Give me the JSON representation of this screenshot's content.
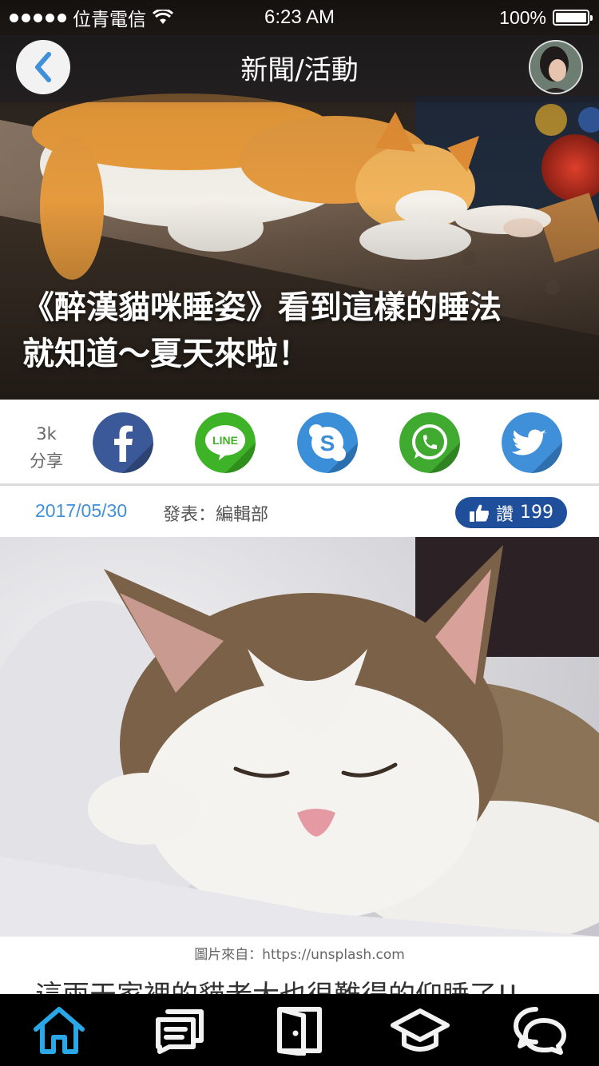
{
  "status_bar": {
    "carrier": "位青電信",
    "time": "6:23 AM",
    "battery": "100%",
    "battery_level": 1.0
  },
  "nav": {
    "title": "新聞/活動",
    "back_icon": "chevron-left-icon",
    "avatar_icon": "profile-avatar"
  },
  "hero": {
    "headline_line1": "《醉漢貓咪睡姿》看到這樣的睡法",
    "headline_line2": "就知道～夏天來啦！"
  },
  "share": {
    "count": "3k",
    "label": "分享",
    "buttons": [
      {
        "name": "facebook",
        "icon": "facebook-icon",
        "color": "#3b5998"
      },
      {
        "name": "line",
        "icon": "line-icon",
        "text": "LINE",
        "color": "#3fb327"
      },
      {
        "name": "skype",
        "icon": "skype-icon",
        "color": "#3a8fd8"
      },
      {
        "name": "whatsapp",
        "icon": "whatsapp-icon",
        "color": "#3faa2f"
      },
      {
        "name": "twitter",
        "icon": "twitter-icon",
        "color": "#3f8fd9"
      }
    ]
  },
  "meta": {
    "date": "2017/05/30",
    "author": "發表：編輯部",
    "like_label": "讚",
    "like_count": "199",
    "like_color": "#1f4f9a"
  },
  "article": {
    "photo_credit": "圖片來自：https://unsplash.com",
    "first_line": "這兩天家裡的貓老大也很難得的仰睡了!!"
  },
  "tab_bar": {
    "active_color": "#29a7e6",
    "tabs": [
      {
        "name": "home",
        "icon": "home-icon",
        "active": true
      },
      {
        "name": "news",
        "icon": "news-icon",
        "active": false
      },
      {
        "name": "door",
        "icon": "door-icon",
        "active": false
      },
      {
        "name": "school",
        "icon": "graduation-cap-icon",
        "active": false
      },
      {
        "name": "chat",
        "icon": "chat-bubbles-icon",
        "active": false
      }
    ]
  }
}
